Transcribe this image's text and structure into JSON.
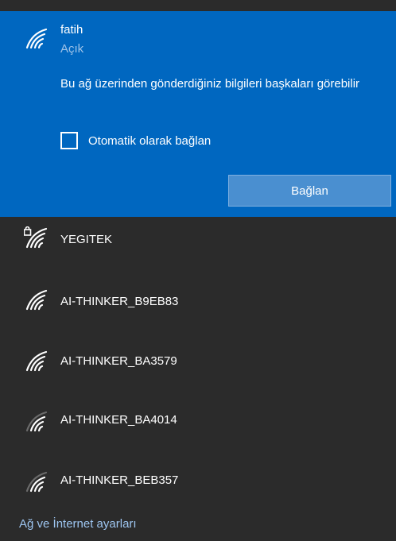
{
  "selected_network": {
    "name": "fatih",
    "status": "Açık",
    "warning": "Bu ağ üzerinden gönderdiğiniz bilgileri başkaları görebilir",
    "auto_connect_label": "Otomatik olarak bağlan",
    "auto_connect_checked": false,
    "connect_button": "Bağlan",
    "icon": "wifi-signal-icon"
  },
  "networks": [
    {
      "name": "YEGITEK",
      "icon": "wifi-secured-icon",
      "secured": true
    },
    {
      "name": "AI-THINKER_B9EB83",
      "icon": "wifi-signal-icon",
      "secured": false
    },
    {
      "name": "AI-THINKER_BA3579",
      "icon": "wifi-signal-icon",
      "secured": false
    },
    {
      "name": "AI-THINKER_BA4014",
      "icon": "wifi-signal-icon",
      "secured": false
    },
    {
      "name": "AI-THINKER_BEB357",
      "icon": "wifi-signal-icon",
      "secured": false
    }
  ],
  "settings_link": "Ağ ve İnternet ayarları",
  "colors": {
    "selected_bg": "#0067c0",
    "panel_bg": "#2b2b2b",
    "link": "#9ec6f1"
  }
}
